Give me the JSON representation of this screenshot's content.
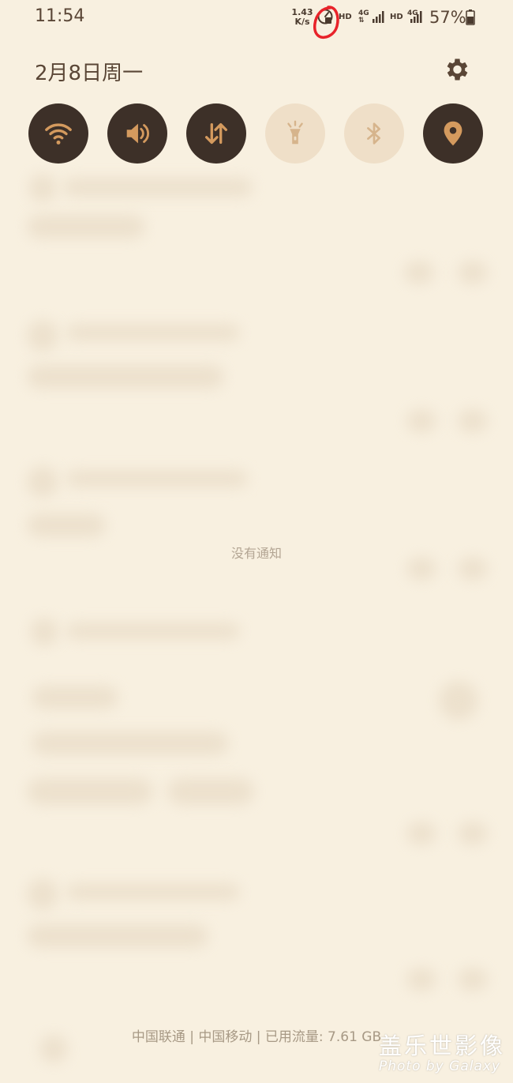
{
  "status_bar": {
    "time": "11:54",
    "net_speed_value": "1.43",
    "net_speed_unit": "K/s",
    "sim1": {
      "hd": "HD",
      "network": "4G"
    },
    "sim2": {
      "hd": "HD",
      "network": "4G"
    },
    "battery": "57%"
  },
  "header": {
    "date": "2月8日周一",
    "settings_icon": "gear-icon"
  },
  "quick_toggles": [
    {
      "name": "wifi",
      "icon": "wifi-icon",
      "state": "on"
    },
    {
      "name": "sound",
      "icon": "speaker-icon",
      "state": "on"
    },
    {
      "name": "mobile-data",
      "icon": "data-arrows-icon",
      "state": "on"
    },
    {
      "name": "flashlight",
      "icon": "flashlight-icon",
      "state": "off"
    },
    {
      "name": "bluetooth",
      "icon": "bluetooth-icon",
      "state": "off"
    },
    {
      "name": "location",
      "icon": "location-pin-icon",
      "state": "on"
    }
  ],
  "notifications": {
    "empty_text": "没有通知"
  },
  "footer": {
    "carrier_text": "中国联通 | 中国移动 | 已用流量: 7.61 GB"
  },
  "watermark": {
    "title": "盖乐世影像",
    "subtitle": "Photo by Galaxy"
  },
  "colors": {
    "background": "#f8f0e0",
    "toggle_on": "#3d3028",
    "toggle_off": "#efdfc8",
    "accent": "#d49a5e",
    "highlight_circle": "#e8232a"
  }
}
